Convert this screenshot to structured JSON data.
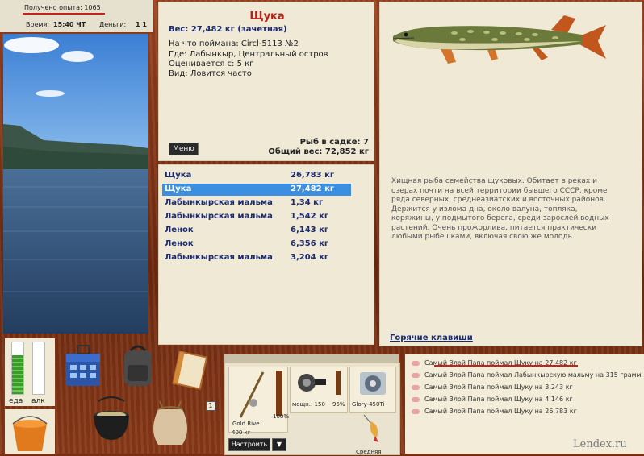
{
  "status": {
    "experience": "Получено опыта: 1065",
    "time_label": "Время:",
    "time_value": "15:40 ЧТ",
    "money_label": "Деньги:",
    "money_value": "1 1"
  },
  "fish": {
    "title": "Щука",
    "weight": "Вес: 27,482 кг (зачетная)",
    "caught_on": "На что поймана: Circl-5113 №2",
    "where": "Где: Лабынкыр, Центральный остров",
    "valued_from": "Оценивается с: 5 кг",
    "kind": "Вид: Ловится часто",
    "menu_label": "Меню",
    "cage_count": "Рыб в садке: 7",
    "total_weight": "Общий вес: 72,852 кг"
  },
  "catch_list": [
    {
      "name": "Щука",
      "weight": "26,783 кг",
      "selected": false
    },
    {
      "name": "Щука",
      "weight": "27,482 кг",
      "selected": true
    },
    {
      "name": "Лабынкырская мальма",
      "weight": "1,34 кг",
      "selected": false
    },
    {
      "name": "Лабынкырская мальма",
      "weight": "1,542 кг",
      "selected": false
    },
    {
      "name": "Ленок",
      "weight": "6,143 кг",
      "selected": false
    },
    {
      "name": "Ленок",
      "weight": "6,356 кг",
      "selected": false
    },
    {
      "name": "Лабынкырская мальма",
      "weight": "3,204 кг",
      "selected": false
    }
  ],
  "description": "Хищная рыба семейства щуковых. Обитает в реках и озерах почти на всей территории бывшего СССР, кроме ряда северных, среднеазиатских и восточных районов. Держится у излома дна, около валуна, топляка, коряжины, у подмытого берега, среди зарослей водных растений. Очень прожорлива, питается практически любыми рыбешками, включая свою же молодь.",
  "hotkeys": "Горячие клавиши",
  "bars": {
    "food_label": "еда",
    "alc_label": "алк",
    "food_level": 0.75,
    "alc_level": 0.0
  },
  "tackle": {
    "rod_name": "Gold Rive...",
    "rod_weight": "400 кг",
    "rod_percent": "100%",
    "reel_label": "мощн.: 150",
    "reel_percent": "95%",
    "line_name": "Glory-450Ti",
    "lure_name": "Средняя",
    "setup_label": "Настроить",
    "dropdown": "▼",
    "badge": "1"
  },
  "log": [
    "Самый Злой Папа поймал Щуку на 27,482 кг",
    "Самый Злой Папа поймал Лабынкырскую мальму на 315 грамм",
    "Самый Злой Папа поймал Щуку на 3,243 кг",
    "Самый Злой Папа поймал Щуку на 4,146 кг",
    "Самый Злой Папа поймал Щуку на 26,783 кг"
  ],
  "watermark": "Lendex.ru",
  "colors": {
    "accent_red": "#b4221a",
    "selection": "#3c8ee0",
    "list_text": "#1c2a6e",
    "wood": "#8a3a18"
  }
}
